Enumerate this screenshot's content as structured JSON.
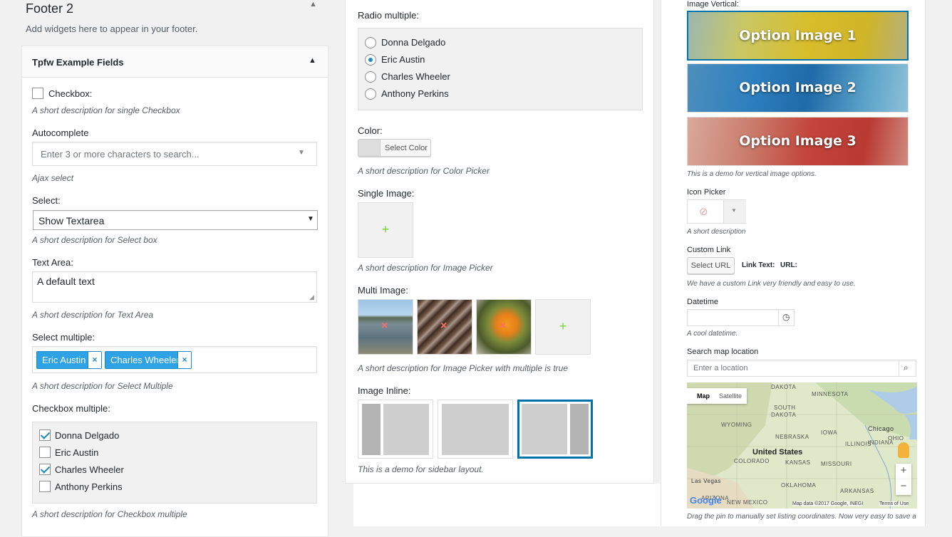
{
  "footer": {
    "title": "Footer 2",
    "subtitle": "Add widgets here to appear in your footer."
  },
  "widget": {
    "title": "Tpfw Example Fields"
  },
  "checkbox": {
    "label": "Checkbox:",
    "desc": "A short description for single Checkbox"
  },
  "autocomplete": {
    "label": "Autocomplete",
    "placeholder": "Enter 3 or more characters to search...",
    "desc": "Ajax select"
  },
  "select": {
    "label": "Select:",
    "value": "Show Textarea",
    "desc": "A short description for Select box"
  },
  "textarea": {
    "label": "Text Area:",
    "value": "A default text",
    "desc": "A short description for Text Area"
  },
  "select_multiple": {
    "label": "Select multiple:",
    "tags": [
      "Eric Austin",
      "Charles Wheeler"
    ],
    "remove_glyph": "×",
    "desc": "A short description for Select Multiple"
  },
  "checkbox_multiple": {
    "label": "Checkbox multiple:",
    "options": [
      {
        "label": "Donna Delgado",
        "checked": true
      },
      {
        "label": "Eric Austin",
        "checked": false
      },
      {
        "label": "Charles Wheeler",
        "checked": true
      },
      {
        "label": "Anthony Perkins",
        "checked": false
      }
    ],
    "desc": "A short description for Checkbox multiple"
  },
  "radio_multiple": {
    "label": "Radio multiple:",
    "options": [
      {
        "label": "Donna Delgado",
        "selected": false
      },
      {
        "label": "Eric Austin",
        "selected": true
      },
      {
        "label": "Charles Wheeler",
        "selected": false
      },
      {
        "label": "Anthony Perkins",
        "selected": false
      }
    ]
  },
  "color": {
    "label": "Color:",
    "button": "Select Color",
    "desc": "A short description for Color Picker"
  },
  "single_image": {
    "label": "Single Image:",
    "add_glyph": "+",
    "desc": "A short description for Image Picker"
  },
  "multi_image": {
    "label": "Multi Image:",
    "add_glyph": "+",
    "remove_glyph": "×",
    "desc": "A short description for Image Picker with multiple is true"
  },
  "image_inline": {
    "label": "Image Inline:",
    "desc": "This is a demo for sidebar layout.",
    "selected_index": 2
  },
  "image_vertical": {
    "label": "Image Vertical:",
    "options": [
      "Option Image 1",
      "Option Image 2",
      "Option Image 3"
    ],
    "selected_index": 0,
    "desc": "This is a demo for vertical image options."
  },
  "icon_picker": {
    "label": "Icon Picker",
    "desc": "A short description"
  },
  "custom_link": {
    "label": "Custom Link",
    "button": "Select URL",
    "link_text": "Link Text:",
    "url": "URL:",
    "desc": "We have a custom Link very friendly and easy to use."
  },
  "datetime": {
    "label": "Datetime",
    "desc": "A cool datetime."
  },
  "map": {
    "label": "Search map location",
    "placeholder": "Enter a location",
    "tab_map": "Map",
    "tab_satellite": "Satellite",
    "country": "United States",
    "places": [
      "DAKOTA",
      "MINNESOTA",
      "SOUTH",
      "DAKOTA",
      "WYOMING",
      "NEBRASKA",
      "IOWA",
      "Chicago",
      "ILLINOIS",
      "INDIANA",
      "OHIO",
      "COLORADO",
      "KANSAS",
      "MISSOURI",
      "Las Vegas",
      "OKLAHOMA",
      "ARIZONA",
      "NEW MEXICO",
      "ARKANSAS"
    ],
    "attribution": "Map data ©2017 Google, INEGI",
    "terms": "Terms of Use",
    "logo": "Google",
    "zoom_in": "+",
    "zoom_out": "−",
    "desc": "Drag the pin to manually set listing coordinates. Now very easy to save a"
  }
}
